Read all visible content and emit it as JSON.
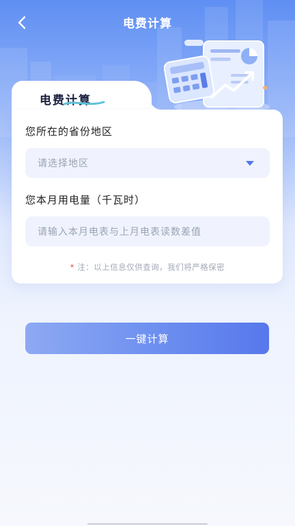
{
  "header": {
    "title": "电费计算",
    "back_icon": "chevron-left-icon"
  },
  "card": {
    "title": "电费计算"
  },
  "form": {
    "region_label": "您所在的省份地区",
    "region_placeholder": "请选择地区",
    "dropdown_icon": "caret-down-icon",
    "usage_label": "您本月用电量（千瓦时）",
    "usage_placeholder": "请输入本月电表与上月电表读数差值",
    "note_star": "*",
    "note_text": " 注：以上信息仅供查询，我们将严格保密"
  },
  "button": {
    "label": "一键计算"
  },
  "colors": {
    "accent": "#5778ec",
    "header_bg": "#5f8ff3",
    "field_bg": "#f0f3fd"
  }
}
